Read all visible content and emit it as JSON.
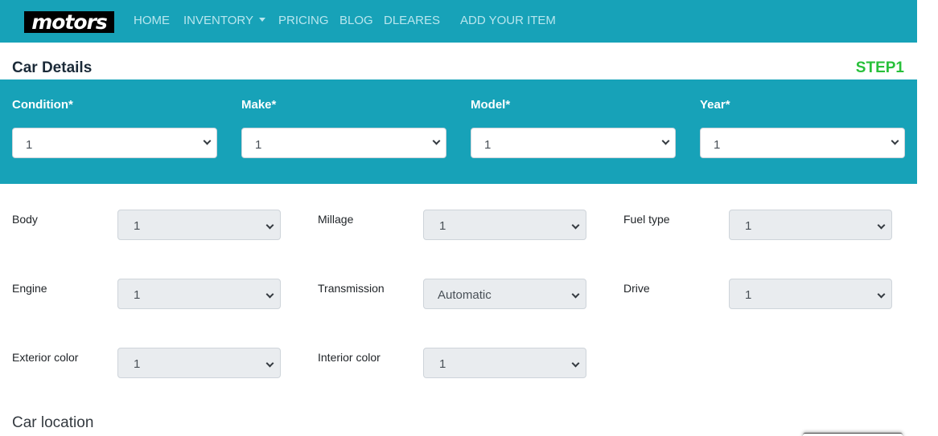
{
  "nav": {
    "logo": "motors",
    "items": [
      "HOME",
      "INVENTORY",
      "PRICING",
      "BLOG",
      "DLEARES",
      "ADD YOUR ITEM"
    ]
  },
  "header": {
    "title": "Car Details",
    "step": "STEP1"
  },
  "primary": {
    "condition": {
      "label": "Condition*",
      "value": "1"
    },
    "make": {
      "label": "Make*",
      "value": "1"
    },
    "model": {
      "label": "Model*",
      "value": "1"
    },
    "year": {
      "label": "Year*",
      "value": "1"
    }
  },
  "details": {
    "body": {
      "label": "Body",
      "value": "1"
    },
    "millage": {
      "label": "Millage",
      "value": "1"
    },
    "fuel_type": {
      "label": "Fuel type",
      "value": "1"
    },
    "engine": {
      "label": "Engine",
      "value": "1"
    },
    "transmission": {
      "label": "Transmission",
      "value": "Automatic"
    },
    "drive": {
      "label": "Drive",
      "value": "1"
    },
    "exterior_color": {
      "label": "Exterior color",
      "value": "1"
    },
    "interior_color": {
      "label": "Interior color",
      "value": "1"
    }
  },
  "location": {
    "title": "Car location"
  },
  "colors": {
    "navbar": "#17a2b8",
    "step": "#28c03a",
    "select_bg": "#e9ecef"
  }
}
